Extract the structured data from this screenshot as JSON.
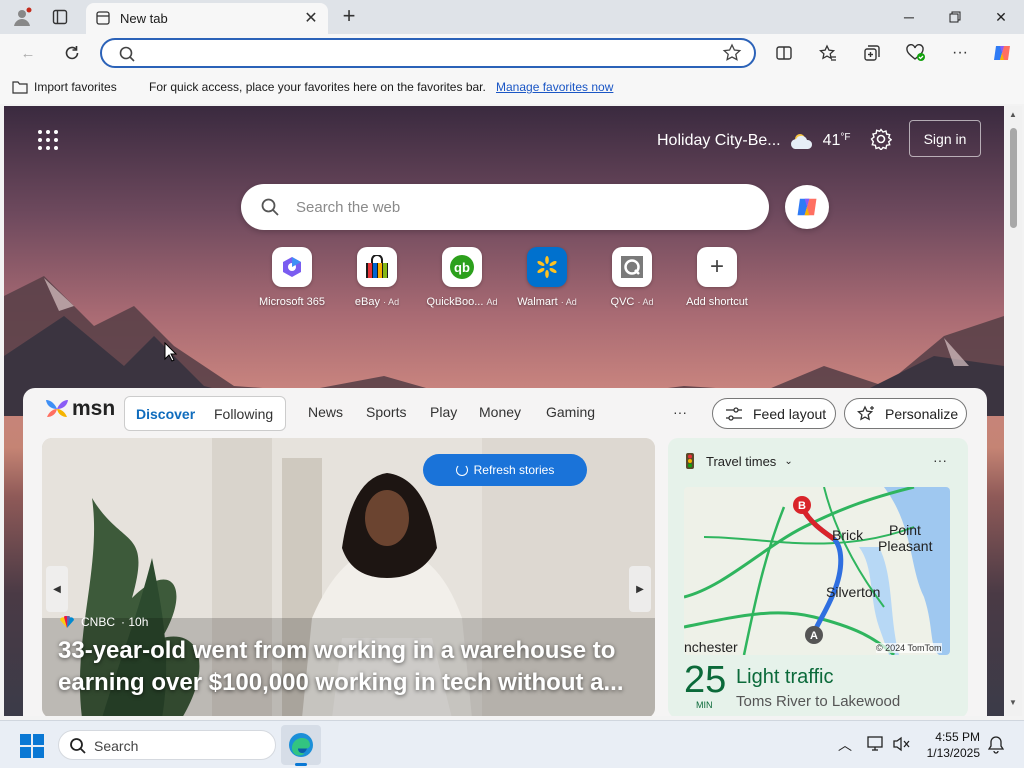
{
  "browser": {
    "tab_title": "New tab",
    "favorites_bar": {
      "import_label": "Import favorites",
      "hint_text": "For quick access, place your favorites here on the favorites bar.",
      "manage_link": "Manage favorites now"
    }
  },
  "newtab": {
    "weather": {
      "location": "Holiday City-Be...",
      "temp": "41",
      "unit": "°F"
    },
    "sign_in_label": "Sign in",
    "search_placeholder": "Search the web",
    "shortcuts": [
      {
        "label": "Microsoft 365",
        "ad": ""
      },
      {
        "label": "eBay",
        "ad": "· Ad"
      },
      {
        "label": "QuickBoo...",
        "ad": "Ad"
      },
      {
        "label": "Walmart",
        "ad": "· Ad"
      },
      {
        "label": "QVC",
        "ad": "· Ad"
      },
      {
        "label": "Add shortcut",
        "ad": ""
      }
    ]
  },
  "msn": {
    "logo_text": "msn",
    "tabs": [
      "Discover",
      "Following"
    ],
    "nav": [
      "News",
      "Sports",
      "Play",
      "Money",
      "Gaming"
    ],
    "more": "···",
    "feed_layout_label": "Feed layout",
    "personalize_label": "Personalize",
    "refresh_label": "Refresh stories",
    "hero": {
      "source": "CNBC",
      "age": "· 10h",
      "title": "33-year-old went from working in a warehouse to earning over $100,000 working in tech without a..."
    },
    "travel": {
      "title": "Travel times",
      "menu": "···",
      "map_labels": [
        "Brick",
        "Point",
        "Pleasant",
        "Silverton",
        "nchester"
      ],
      "map_credit": "© 2024 TomTom",
      "minutes": "25",
      "minutes_unit": "MIN",
      "status": "Light traffic",
      "route": "Toms River to Lakewood"
    }
  },
  "taskbar": {
    "search_placeholder": "Search",
    "time": "4:55 PM",
    "date": "1/13/2025"
  }
}
